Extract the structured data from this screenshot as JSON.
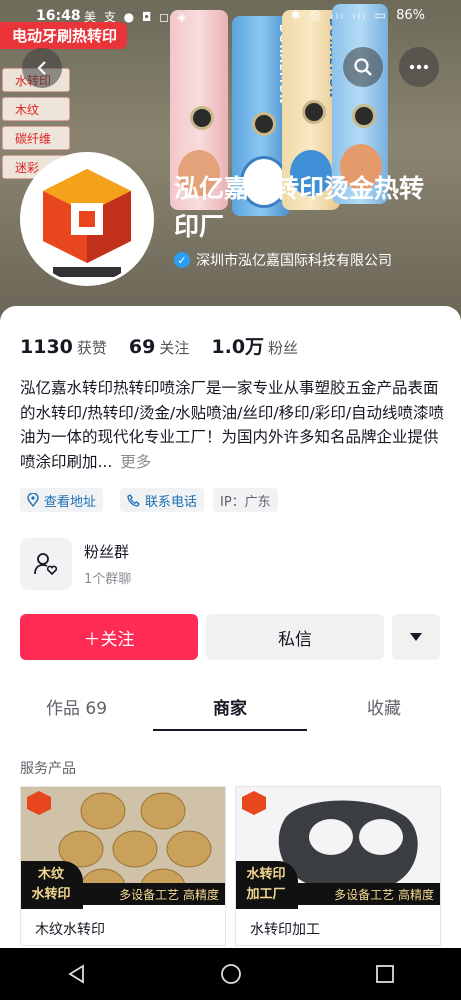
{
  "status_bar": {
    "time": "16:48",
    "left_icons": "美 支 ● ◘ ◻ ◈",
    "right_icons": "✱ ◎ ᵢₗₗ ᵢₗₗ ▭",
    "battery": "86%"
  },
  "banner": {
    "title": "电动牙刷热转印",
    "side_tags": [
      "水转印",
      "木纹",
      "碳纤维",
      "迷彩"
    ],
    "tube_brand": "DORAEMON"
  },
  "profile": {
    "name": "泓亿嘉水转印烫金热转印厂",
    "company": "深圳市泓亿嘉国际科技有限公司"
  },
  "stats": [
    {
      "num": "1130",
      "label": "获赞"
    },
    {
      "num": "69",
      "label": "关注"
    },
    {
      "num": "1.0万",
      "label": "粉丝"
    }
  ],
  "bio": {
    "text": "泓亿嘉水转印热转印喷涂厂是一家专业从事塑胶五金产品表面的水转印/热转印/烫金/水贴喷油/丝印/移印/彩印/自动线喷漆喷油为一体的现代化专业工厂！为国内外许多知名品牌企业提供喷涂印刷加...",
    "more": "更多"
  },
  "chips": {
    "address": "查看地址",
    "phone": "联系电话",
    "ip": "IP：广东"
  },
  "fan_group": {
    "title": "粉丝群",
    "sub": "1个群聊"
  },
  "actions": {
    "follow": "＋关注",
    "message": "私信"
  },
  "tabs": [
    "作品 69",
    "商家",
    "收藏"
  ],
  "section_title": "服务产品",
  "products": [
    {
      "badge_line1": "木纹",
      "badge_line2": "水转印",
      "band": "多设备工艺 高精度",
      "name": "木纹水转印"
    },
    {
      "badge_line1": "水转印",
      "badge_line2": "加工厂",
      "band": "多设备工艺 高精度",
      "name": "水转印加工"
    }
  ],
  "colors": {
    "accent": "#fe2c55",
    "verified": "#2b9ef3",
    "link": "#1a6fb4"
  }
}
